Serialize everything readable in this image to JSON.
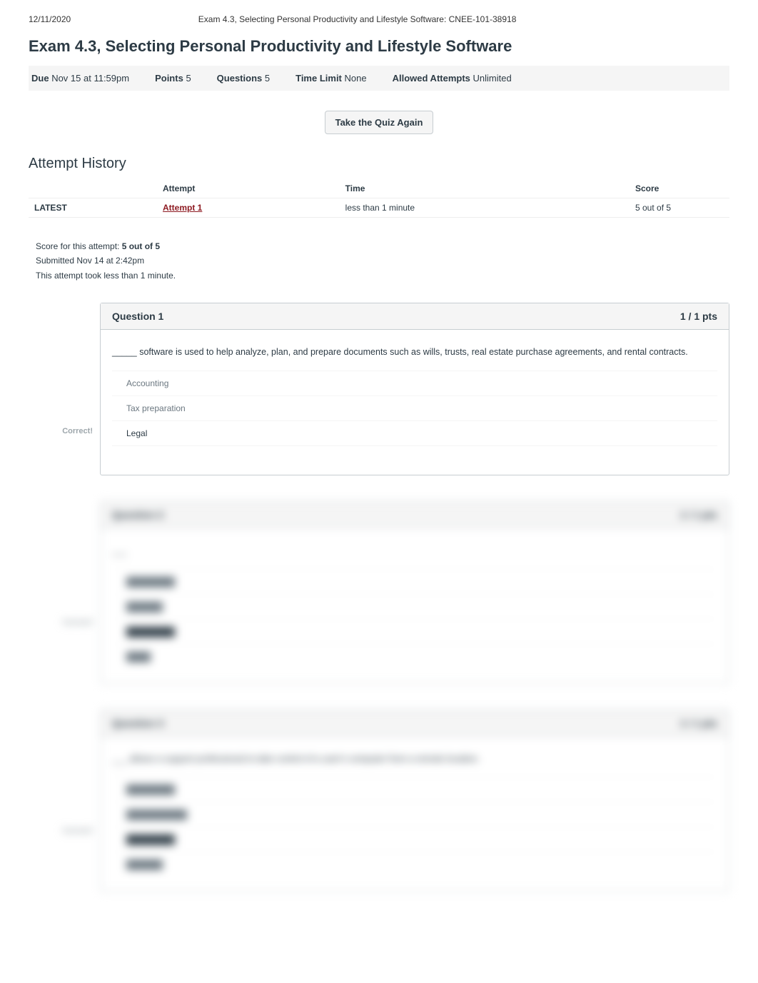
{
  "page_header": {
    "date": "12/11/2020",
    "doc_title": "Exam 4.3, Selecting Personal Productivity and Lifestyle Software: CNEE-101-38918"
  },
  "exam_title": "Exam 4.3, Selecting Personal Productivity and Lifestyle Software",
  "meta": {
    "due_label": "Due",
    "due_value": "Nov 15 at 11:59pm",
    "points_label": "Points",
    "points_value": "5",
    "questions_label": "Questions",
    "questions_value": "5",
    "timelimit_label": "Time Limit",
    "timelimit_value": "None",
    "attempts_label": "Allowed Attempts",
    "attempts_value": "Unlimited"
  },
  "take_again_label": "Take the Quiz Again",
  "history_heading": "Attempt History",
  "history_headers": {
    "blank": "",
    "attempt": "Attempt",
    "time": "Time",
    "score": "Score"
  },
  "history_row": {
    "latest": "LATEST",
    "attempt": "Attempt 1",
    "time": "less than 1 minute",
    "score": "5 out of 5"
  },
  "summary": {
    "score_prefix": "Score for this attempt: ",
    "score_value": "5 out of 5",
    "submitted": "Submitted Nov 14 at 2:42pm",
    "took": "This attempt took less than 1 minute."
  },
  "correct_label": "Correct!",
  "q1": {
    "title": "Question 1",
    "pts": "1 / 1 pts",
    "text": "_____ software is used to help analyze, plan, and prepare documents such as wills, trusts, real estate purchase agreements, and rental contracts.",
    "answers": [
      "Accounting",
      "Tax preparation",
      "Legal",
      ""
    ],
    "correct_index": 2
  },
  "q2": {
    "title": "Question 2",
    "pts": "1 / 1 pts",
    "text": "___",
    "answers": [
      "",
      "",
      "",
      ""
    ],
    "correct_index": 2
  },
  "q3": {
    "title": "Question 3",
    "pts": "1 / 1 pts",
    "text": "___ allows a support professional to take control of a user's computer from a remote location.",
    "answers": [
      "",
      "",
      "",
      ""
    ],
    "correct_index": 2
  }
}
